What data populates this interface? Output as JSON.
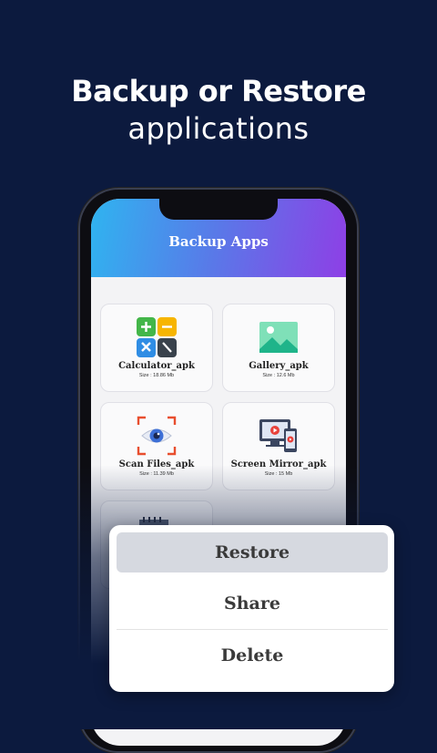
{
  "headline": {
    "line1": "Backup or Restore",
    "line2": "applications"
  },
  "app": {
    "title": "Backup Apps",
    "apps": [
      {
        "name": "Calculator_apk",
        "size": "Size : 18.86 Mb",
        "icon": "calculator-icon"
      },
      {
        "name": "Gallery_apk",
        "size": "Size : 12.6 Mb",
        "icon": "gallery-icon"
      },
      {
        "name": "Scan Files_apk",
        "size": "Size : 11.39 Mb",
        "icon": "scan-eye-icon"
      },
      {
        "name": "Screen Mirror_apk",
        "size": "Size : 15 Mb",
        "icon": "screen-mirror-icon"
      },
      {
        "name": "",
        "size": "",
        "icon": "notepad-icon"
      }
    ]
  },
  "menu": {
    "options": [
      "Restore",
      "Share",
      "Delete"
    ],
    "selected": "Restore"
  },
  "colors": {
    "background": "#0c1a3e",
    "header_gradient_start": "#2fb4f0",
    "header_gradient_end": "#8e3fe6",
    "selected_option": "#d6d9e0"
  }
}
